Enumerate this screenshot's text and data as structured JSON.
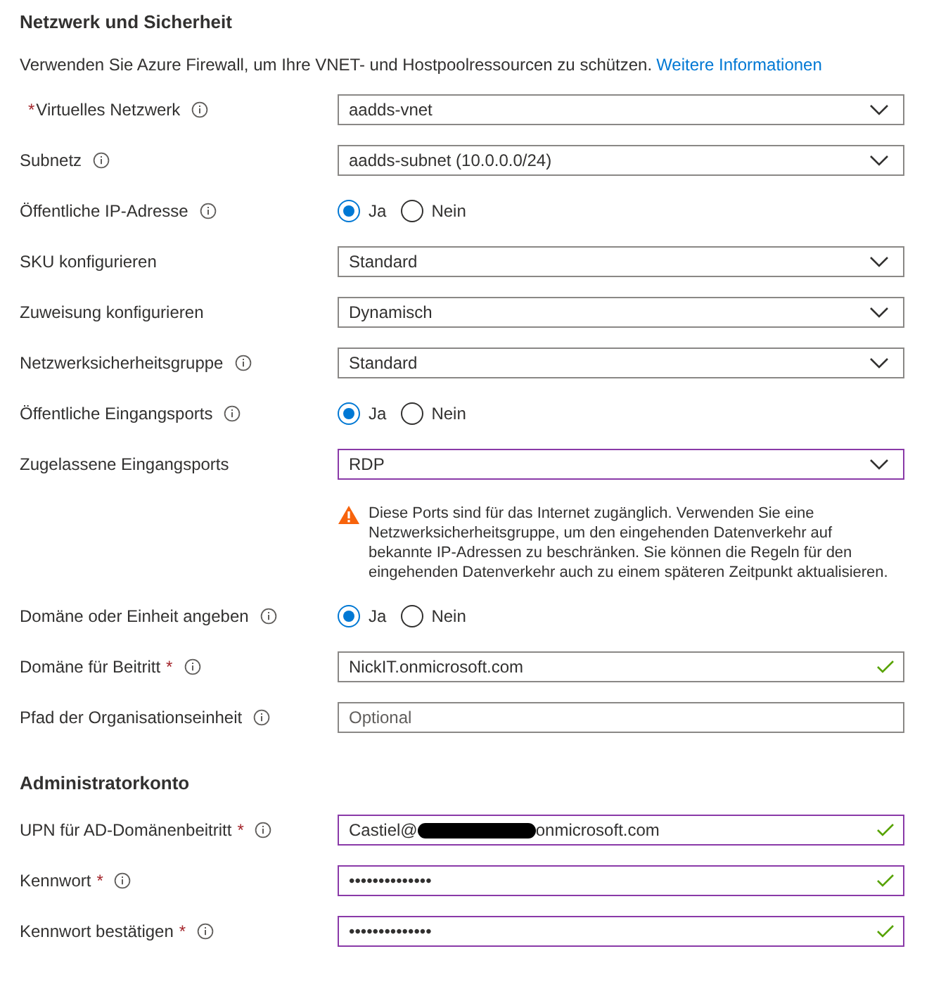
{
  "sections": [
    {
      "heading": "Netzwerk und Sicherheit",
      "description": {
        "text": "Verwenden Sie Azure Firewall, um Ihre VNET- und Hostpoolressourcen zu schützen.",
        "link": "Weitere Informationen"
      },
      "rows": [
        {
          "kind": "dropdown",
          "label": "Virtuelles Netzwerk",
          "mark_before": "*",
          "info": true,
          "value": "aadds-vnet",
          "highlighted": false
        },
        {
          "kind": "dropdown",
          "label": "Subnetz",
          "info": true,
          "value": "aadds-subnet (10.0.0.0/24)",
          "highlighted": false
        },
        {
          "kind": "radio",
          "label": "Öffentliche IP-Adresse",
          "info": true,
          "options": [
            {
              "label": "Ja",
              "selected": true
            },
            {
              "label": "Nein",
              "selected": false
            }
          ]
        },
        {
          "kind": "dropdown",
          "label": "SKU konfigurieren",
          "info": false,
          "value": "Standard",
          "highlighted": false
        },
        {
          "kind": "dropdown",
          "label": "Zuweisung konfigurieren",
          "info": false,
          "value": "Dynamisch",
          "highlighted": false
        },
        {
          "kind": "dropdown",
          "label": "Netzwerksicherheitsgruppe",
          "info": true,
          "value": "Standard",
          "highlighted": false
        },
        {
          "kind": "radio",
          "label": "Öffentliche Eingangsports",
          "info": true,
          "options": [
            {
              "label": "Ja",
              "selected": true
            },
            {
              "label": "Nein",
              "selected": false
            }
          ]
        },
        {
          "kind": "dropdown",
          "label": "Zugelassene Eingangsports",
          "info": false,
          "value": "RDP",
          "highlighted": true
        },
        {
          "kind": "warning",
          "text": "Diese Ports sind für das Internet zugänglich. Verwenden Sie eine Netzwerksicherheitsgruppe, um den eingehenden Datenverkehr auf bekannte IP-Adressen zu beschränken. Sie können die Regeln für den eingehenden Datenverkehr auch zu einem späteren Zeitpunkt aktualisieren."
        },
        {
          "kind": "radio",
          "label": "Domäne oder Einheit angeben",
          "info": true,
          "options": [
            {
              "label": "Ja",
              "selected": true
            },
            {
              "label": "Nein",
              "selected": false
            }
          ]
        },
        {
          "kind": "text",
          "label": "Domäne für Beitritt",
          "mark_after": "*",
          "info": true,
          "value": "NickIT.onmicrosoft.com",
          "valid": true,
          "highlighted": false
        },
        {
          "kind": "text",
          "label": "Pfad der Organisationseinheit",
          "info": true,
          "placeholder": "Optional",
          "valid": false,
          "highlighted": false
        }
      ]
    },
    {
      "heading": "Administratorkonto",
      "rows": [
        {
          "kind": "text",
          "label": "UPN für AD-Domänenbeitritt",
          "mark_after": "*",
          "info": true,
          "value": "Castiel@",
          "redacted": true,
          "value_after": "onmicrosoft.com",
          "valid": true,
          "highlighted": true
        },
        {
          "kind": "password",
          "label": "Kennwort",
          "mark_after": "*",
          "info": true,
          "value": "••••••••••••••",
          "valid": true,
          "highlighted": true
        },
        {
          "kind": "password",
          "label": "Kennwort bestätigen",
          "mark_after": "*",
          "info": true,
          "value": "••••••••••••••",
          "valid": true,
          "highlighted": true
        }
      ]
    }
  ]
}
